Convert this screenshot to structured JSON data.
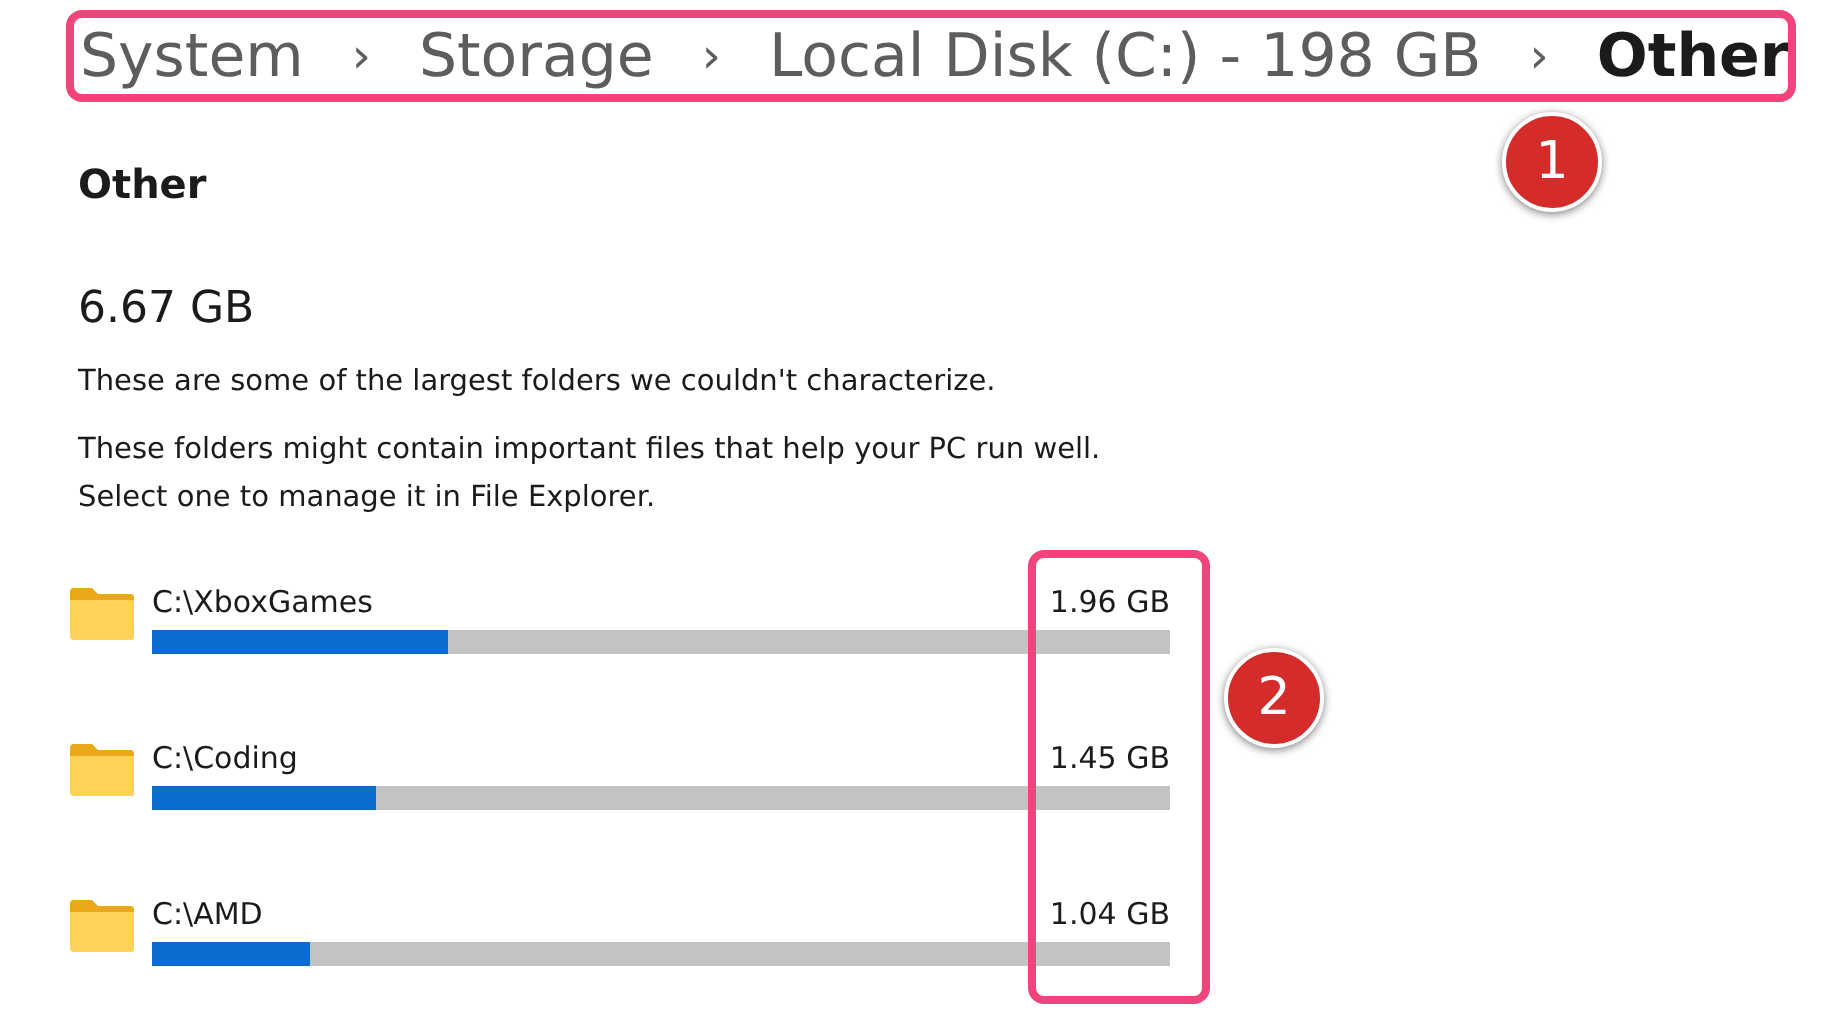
{
  "breadcrumb": [
    {
      "label": "System",
      "current": false
    },
    {
      "label": "Storage",
      "current": false
    },
    {
      "label": "Local Disk (C:) - 198 GB",
      "current": false
    },
    {
      "label": "Other",
      "current": true
    }
  ],
  "separator": "›",
  "heading": "Other",
  "total": "6.67 GB",
  "description": "These are some of the largest folders we couldn't characterize.",
  "hint": [
    "These folders might contain important files that help your PC run well.",
    "Select one to manage it in File Explorer."
  ],
  "folders": [
    {
      "path": "C:\\XboxGames",
      "size": "1.96 GB",
      "level": 0.29
    },
    {
      "path": "C:\\Coding",
      "size": "1.45 GB",
      "level": 0.22
    },
    {
      "path": "C:\\AMD",
      "size": "1.04 GB",
      "level": 0.155
    }
  ],
  "annotations": [
    {
      "number": "1"
    },
    {
      "number": "2"
    }
  ]
}
